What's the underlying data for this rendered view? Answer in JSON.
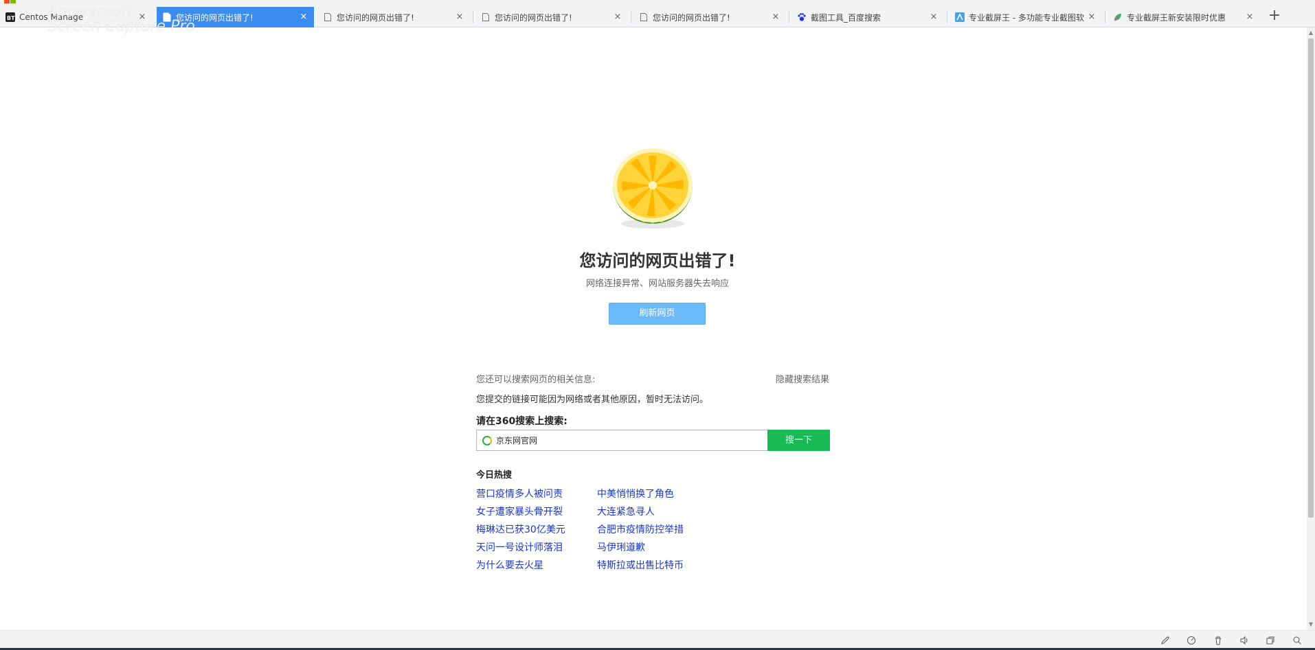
{
  "browser": {
    "watermark": {
      "line1": "Apowersoft",
      "line2": "Screen Capture Pro"
    },
    "tabs": [
      {
        "title": "Centos Manage",
        "icon": "bt-panel-icon"
      },
      {
        "title": "您访问的网页出错了!",
        "icon": "page-icon",
        "active": true
      },
      {
        "title": "您访问的网页出错了!",
        "icon": "page-icon"
      },
      {
        "title": "您访问的网页出错了!",
        "icon": "page-icon"
      },
      {
        "title": "您访问的网页出错了!",
        "icon": "page-icon"
      },
      {
        "title": "截图工具_百度搜索",
        "icon": "baidu-paw-icon"
      },
      {
        "title": "专业截屏王 - 多功能专业截图软",
        "icon": "screenshot-app-icon"
      },
      {
        "title": "专业截屏王新安装限时优惠",
        "icon": "leaf-icon"
      }
    ],
    "new_tab_symbol": "+",
    "colors": {
      "active_tab": "#3c8cf0",
      "link": "#1b37c8",
      "search_button": "#19b955",
      "refresh_button": "#6cbaf8"
    }
  },
  "error_page": {
    "title": "您访问的网页出错了!",
    "subtitle": "网络连接异常、网站服务器失去响应",
    "refresh_label": "刷新网页",
    "search_hint": "您还可以搜索网页的相关信息:",
    "hide_results_label": "隐藏搜索结果",
    "reason": "您提交的链接可能因为网络或者其他原因，暂时无法访问。",
    "search_label": "请在360搜索上搜索:",
    "search_value": "京东网官网",
    "search_button_label": "搜一下",
    "hot_title": "今日热搜",
    "hot_left": [
      "营口疫情多人被问责",
      "女子遭家暴头骨开裂",
      "梅琳达已获30亿美元",
      "天问一号设计师落泪",
      "为什么要去火星"
    ],
    "hot_right": [
      "中美悄悄换了角色",
      "大连紧急寻人",
      "合肥市疫情防控举措",
      "马伊琍道歉",
      "特斯拉或出售比特币"
    ]
  },
  "statusbar": {
    "icons": [
      "rocket-icon",
      "speed-icon",
      "trash-icon",
      "volume-icon",
      "window-icon",
      "zoom-icon"
    ]
  }
}
